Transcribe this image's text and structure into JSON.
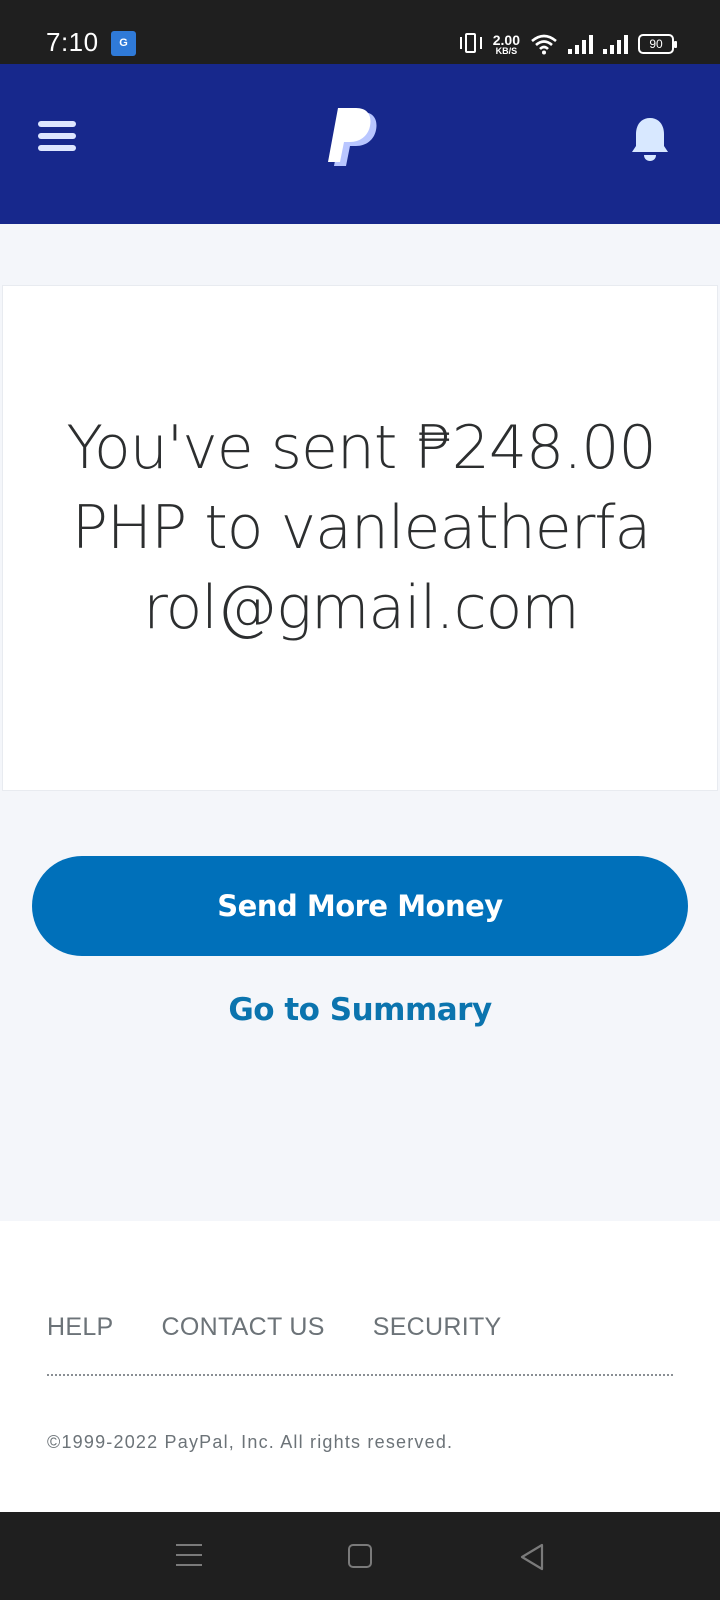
{
  "status_bar": {
    "time": "7:10",
    "app_icon_text": "G",
    "net_speed_value": "2.00",
    "net_speed_unit": "KB/S",
    "battery": "90"
  },
  "header": {
    "menu_icon": "hamburger-menu-icon",
    "logo": "paypal-logo",
    "notification_icon": "bell-icon",
    "brand_color": "#17288c"
  },
  "confirmation": {
    "message": "You've sent ₱248.00 PHP to vanleatherfarol@gmail.com"
  },
  "actions": {
    "send_more_label": "Send More Money",
    "send_more_color": "#0070ba",
    "summary_label": "Go to Summary"
  },
  "footer": {
    "links": [
      "HELP",
      "CONTACT US",
      "SECURITY"
    ],
    "copyright": "©1999-2022 PayPal, Inc. All rights reserved."
  },
  "nav_bar": {
    "icons": [
      "recent-apps-icon",
      "home-icon",
      "back-icon"
    ]
  }
}
